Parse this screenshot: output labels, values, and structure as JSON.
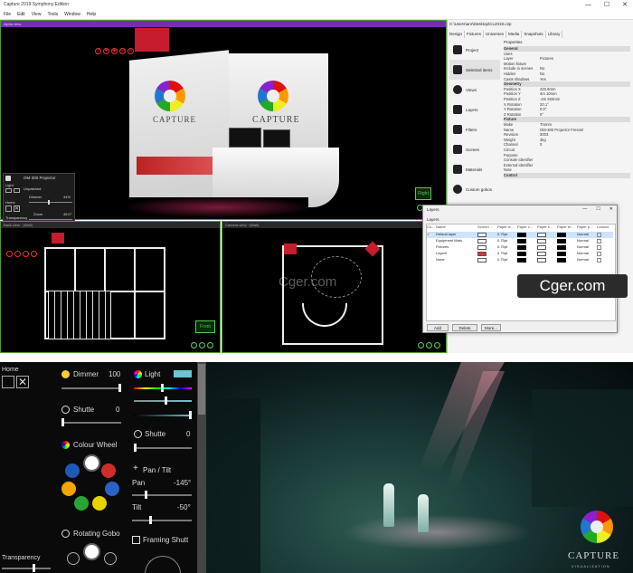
{
  "window": {
    "title": "Capture 2019 Symphony Edition",
    "minimize": "—",
    "maximize": "☐",
    "close": "✕"
  },
  "menu": [
    "File",
    "Edit",
    "View",
    "Tools",
    "Window",
    "Help"
  ],
  "viewports": {
    "alpha": {
      "title": "Alpha view"
    },
    "front": {
      "title": "Back view · (Wall)",
      "label": "Front"
    },
    "top": {
      "title": "Camera view · (Wall)"
    },
    "alpha_label": "Right"
  },
  "booth": {
    "brand": "CAPTURE",
    "sub": "VISUALIZATION"
  },
  "projector_panel": {
    "title": "OM-300 Projector",
    "light": "Light",
    "unpatched": "Unpatched",
    "dimmer_label": "Dimmer",
    "dimmer_value": "44%",
    "home": "Home",
    "zoom_label": "Zoom",
    "zoom_value": "45.0°",
    "transparency": "Transparency",
    "dimmer_level": 0.44
  },
  "props_path": "C:\\Users\\anr\\Desktop\\CL2019.c2p",
  "props_tabs": [
    "Design",
    "Fixtures",
    "Universes",
    "Media",
    "Snapshots",
    "Library"
  ],
  "sidenav": [
    "Project",
    "Selected items",
    "Views",
    "Layers",
    "Filters",
    "Scenes",
    "Materials",
    "Custom gobos",
    "Frame lists"
  ],
  "props_header": "Properties",
  "props": [
    {
      "k": "General",
      "v": "",
      "section": true
    },
    {
      "k": "Uses",
      "v": ""
    },
    {
      "k": "Layer",
      "v": "Fixtures"
    },
    {
      "k": "Motion fixture",
      "v": ""
    },
    {
      "k": "Include in scenes",
      "v": "No"
    },
    {
      "k": "Hidden",
      "v": "No"
    },
    {
      "k": "Casts shadows",
      "v": "Yes"
    },
    {
      "k": "Geometry",
      "v": "",
      "section": true
    },
    {
      "k": "Position X",
      "v": "420.9mm"
    },
    {
      "k": "Position Y",
      "v": "4m 10mm"
    },
    {
      "k": "Position Z",
      "v": "-4m 503mm"
    },
    {
      "k": "X Rotation",
      "v": "20.1°"
    },
    {
      "k": "Y Rotation",
      "v": "0.0°"
    },
    {
      "k": "Z Rotation",
      "v": "0°"
    },
    {
      "k": "Fixture",
      "v": "",
      "section": true
    },
    {
      "k": "Make",
      "v": "Tmmm"
    },
    {
      "k": "Name",
      "v": "OM-300 Projector Fresnel"
    },
    {
      "k": "Revision",
      "v": "3003"
    },
    {
      "k": "Weight",
      "v": "3kg"
    },
    {
      "k": "Channel",
      "v": "0"
    },
    {
      "k": "Circuit",
      "v": ""
    },
    {
      "k": "Purpose",
      "v": ""
    },
    {
      "k": "Console identifier",
      "v": ""
    },
    {
      "k": "External identifier",
      "v": ""
    },
    {
      "k": "Note",
      "v": ""
    },
    {
      "k": "Control",
      "v": "",
      "section": true
    }
  ],
  "layers_dialog": {
    "title": "Layers",
    "group_label": "Layers",
    "columns": [
      "Cu...",
      "Name",
      "Screen ...",
      "Paper w...",
      "Paper c...",
      "Paper s...",
      "Paper te...",
      "Paper p...",
      "Locked"
    ],
    "rows": [
      {
        "name": "Default layer",
        "w": "0.75pt",
        "p": "Normal",
        "current": true,
        "swatch": "white"
      },
      {
        "name": "Equipment Main",
        "w": "0.75pt",
        "p": "Normal",
        "swatch": "white"
      },
      {
        "name": "Fixtures",
        "w": "0.75pt",
        "p": "Normal",
        "swatch": "white"
      },
      {
        "name": "Layer0",
        "w": "0.75pt",
        "p": "Normal",
        "swatch": "red"
      },
      {
        "name": "None",
        "w": "0.75pt",
        "p": "Normal",
        "swatch": "white"
      }
    ],
    "buttons": [
      "Add",
      "Delete",
      "More..."
    ]
  },
  "watermark": "Cger.com",
  "watermark_small": "Cger.com",
  "bottom": {
    "home": "Home",
    "dimmer": "Dimmer",
    "dimmer_value": "100",
    "shutter1": "Shutte",
    "shutter1_value": "0",
    "light": "Light",
    "colour_wheel": "Colour Wheel",
    "shutter2": "Shutte",
    "shutter2_value": "0",
    "pan_tilt": "Pan / Tilt",
    "pan": "Pan",
    "pan_value": "-145°",
    "tilt": "Tilt",
    "tilt_value": "-50°",
    "rotating_gobo": "Rotating Gobo",
    "framing_shutt": "Framing Shutt",
    "transparency": "Transparency"
  },
  "stage_logo": {
    "brand": "CAPTURE",
    "sub": "VISUALIZATION"
  },
  "colors": {
    "accent": "#7b2bb0",
    "viewport_border": "#4e9a3a",
    "fixture_red": "#e33333"
  }
}
